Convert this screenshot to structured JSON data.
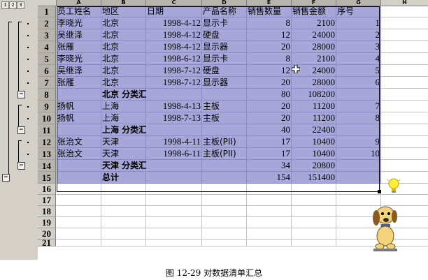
{
  "outline_levels": [
    "1",
    "2",
    "3"
  ],
  "columns": [
    "A",
    "B",
    "C",
    "D",
    "E",
    "F",
    "G",
    "H"
  ],
  "rows": [
    {
      "num": "1",
      "cells": [
        "员工姓名",
        "地区",
        "日期",
        "产品名称",
        "销售数量",
        "销售金额",
        "序号"
      ],
      "header": true
    },
    {
      "num": "2",
      "cells": [
        "李晓光",
        "北京",
        "1998-4-12",
        "显示卡",
        "8",
        "2100",
        "1"
      ]
    },
    {
      "num": "3",
      "cells": [
        "吴继泽",
        "北京",
        "1998-4-12",
        "硬盘",
        "12",
        "24000",
        "2"
      ]
    },
    {
      "num": "4",
      "cells": [
        "张雁",
        "北京",
        "1998-4-12",
        "显示器",
        "20",
        "28000",
        "3"
      ]
    },
    {
      "num": "5",
      "cells": [
        "李晓光",
        "北京",
        "1998-6-12",
        "显示卡",
        "8",
        "2100",
        "4"
      ]
    },
    {
      "num": "6",
      "cells": [
        "吴继泽",
        "北京",
        "1998-7-12",
        "硬盘",
        "12",
        "24000",
        "5"
      ]
    },
    {
      "num": "7",
      "cells": [
        "张雁",
        "北京",
        "1998-7-12",
        "显示器",
        "20",
        "28000",
        "6"
      ]
    },
    {
      "num": "8",
      "cells": [
        "",
        "北京 分类汇总",
        "",
        "",
        "80",
        "108200",
        ""
      ],
      "subtotal": true
    },
    {
      "num": "9",
      "cells": [
        "扬帆",
        "上海",
        "1998-4-13",
        "主板",
        "20",
        "11200",
        "7"
      ]
    },
    {
      "num": "10",
      "cells": [
        "扬帆",
        "上海",
        "1998-7-13",
        "主板",
        "20",
        "11200",
        "8"
      ]
    },
    {
      "num": "11",
      "cells": [
        "",
        "上海 分类汇总",
        "",
        "",
        "40",
        "22400",
        ""
      ],
      "subtotal": true
    },
    {
      "num": "12",
      "cells": [
        "张治文",
        "天津",
        "1998-4-11",
        "主板(PII)",
        "17",
        "10400",
        "9"
      ]
    },
    {
      "num": "13",
      "cells": [
        "张治文",
        "天津",
        "1998-6-11",
        "主板(PII)",
        "17",
        "10400",
        "10"
      ]
    },
    {
      "num": "14",
      "cells": [
        "",
        "天津 分类汇总",
        "",
        "",
        "34",
        "20800",
        ""
      ],
      "subtotal": true
    },
    {
      "num": "15",
      "cells": [
        "",
        "总计",
        "",
        "",
        "154",
        "151400",
        ""
      ],
      "subtotal": true
    },
    {
      "num": "16",
      "cells": [
        "",
        "",
        "",
        "",
        "",
        "",
        ""
      ]
    },
    {
      "num": "17",
      "cells": [
        "",
        "",
        "",
        "",
        "",
        "",
        ""
      ]
    },
    {
      "num": "18",
      "cells": [
        "",
        "",
        "",
        "",
        "",
        "",
        ""
      ]
    },
    {
      "num": "19",
      "cells": [
        "",
        "",
        "",
        "",
        "",
        "",
        ""
      ]
    },
    {
      "num": "20",
      "cells": [
        "",
        "",
        "",
        "",
        "",
        "",
        ""
      ]
    },
    {
      "num": "21",
      "cells": [
        "",
        "",
        "",
        "",
        "",
        "",
        ""
      ]
    }
  ],
  "caption": "图 12-29  对数据清单汇总",
  "colors": {
    "selection": "#a6a6d8",
    "header_bg": "#d4d0c8",
    "grid": "#c0c0c0"
  },
  "icons": [
    "outline-collapse-icon",
    "move-cursor-icon",
    "lightbulb-icon",
    "office-assistant-dog-icon"
  ]
}
